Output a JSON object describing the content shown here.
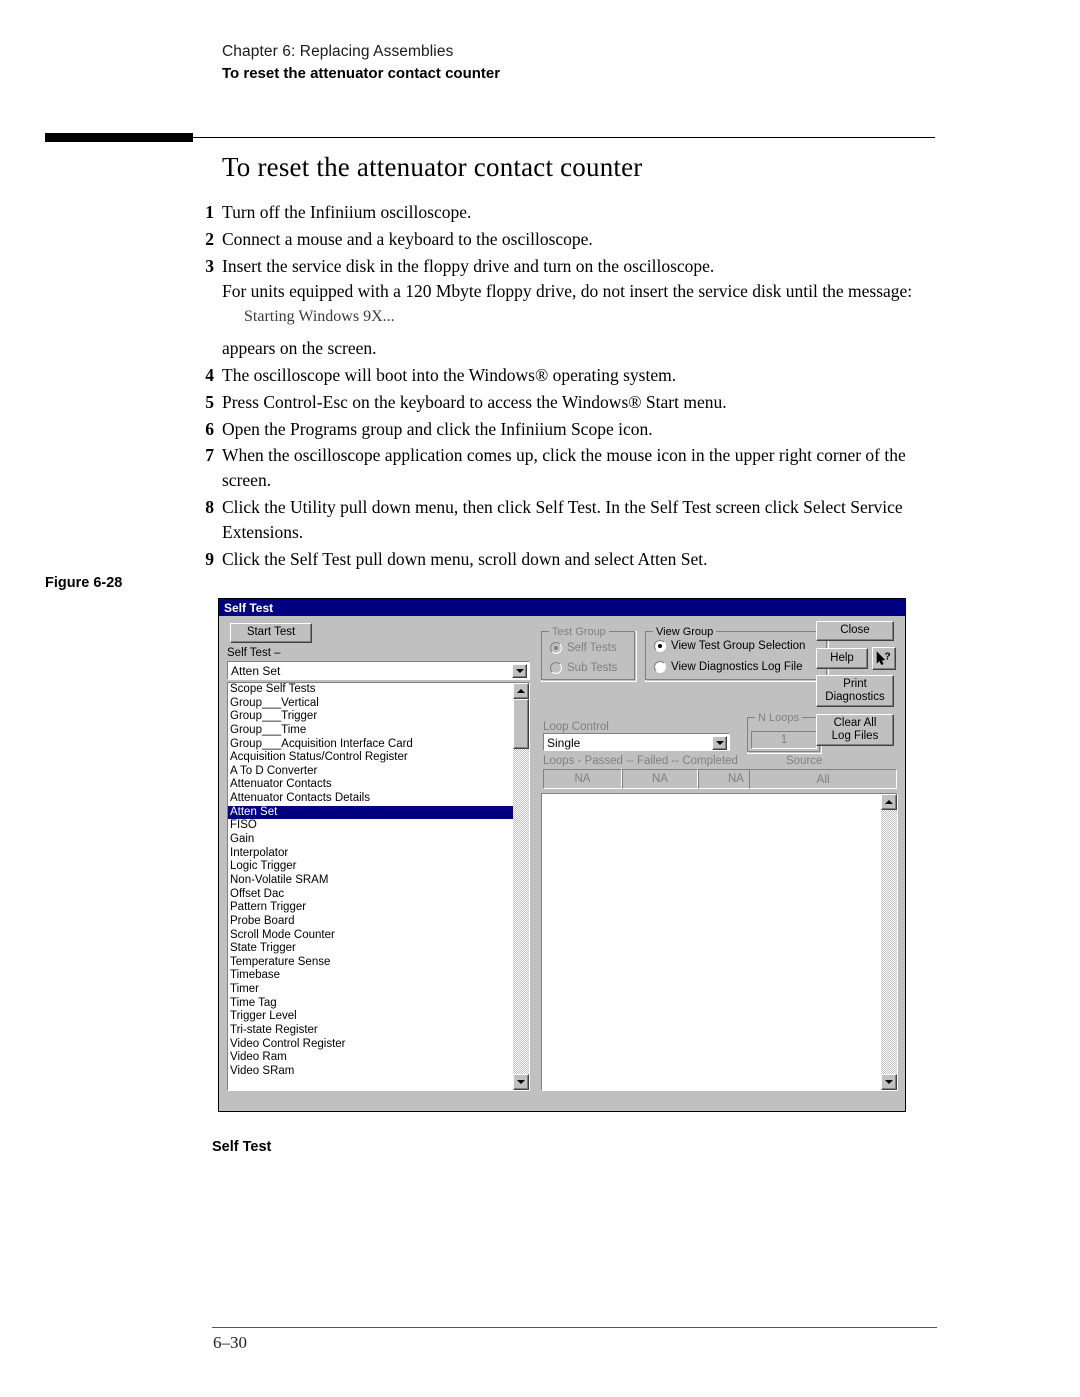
{
  "running_head": {
    "chapter": "Chapter 6: Replacing Assemblies",
    "section": "To reset the attenuator contact counter"
  },
  "page_title": "To reset the attenuator contact counter",
  "steps": [
    {
      "num": "1",
      "text": "Turn off the Infiniium oscilloscope."
    },
    {
      "num": "2",
      "text": "Connect a mouse and a keyboard to the oscilloscope."
    },
    {
      "num": "3",
      "text": "Insert the service disk in the floppy drive and turn on the oscilloscope.",
      "text2": "For units equipped with a 120 Mbyte floppy drive, do not insert the service disk until the message:",
      "code": "Starting Windows 9X...",
      "after": "appears on the screen."
    },
    {
      "num": "4",
      "text": "The oscilloscope will boot into the Windows® operating system."
    },
    {
      "num": "5",
      "text": "Press Control-Esc on the keyboard to access the Windows® Start menu."
    },
    {
      "num": "6",
      "text": "Open the Programs group and click the Infiniium Scope icon."
    },
    {
      "num": "7",
      "text": "When the oscilloscope application comes up, click the mouse icon in the upper right corner of the screen."
    },
    {
      "num": "8",
      "text": "Click the Utility pull down menu, then click Self Test. In the Self Test screen click Select Service Extensions."
    },
    {
      "num": "9",
      "text": "Click the Self Test pull down menu, scroll down and select Atten Set."
    }
  ],
  "figure": {
    "label": "Figure 6-28",
    "caption": "Self Test"
  },
  "footer": {
    "page_number": "6–30"
  },
  "dialog": {
    "title": "Self Test",
    "start_test_label": "Start Test",
    "selftest_label": "Self Test –",
    "selftest_selected": "Atten Set",
    "list_items": [
      "Scope Self Tests",
      "Group___Vertical",
      "Group___Trigger",
      "Group___Time",
      "Group___Acquisition Interface Card",
      "Acquisition Status/Control Register",
      "A To D Converter",
      "Attenuator Contacts",
      "Attenuator Contacts Details",
      "Atten Set",
      "FISO",
      "Gain",
      "Interpolator",
      "Logic Trigger",
      "Non-Volatile SRAM",
      "Offset Dac",
      "Pattern Trigger",
      "Probe Board",
      "Scroll Mode Counter",
      "State Trigger",
      "Temperature Sense",
      "Timebase",
      "Timer",
      "Time Tag",
      "Trigger Level",
      "Tri-state Register",
      "Video Control Register",
      "Video Ram",
      "Video SRam"
    ],
    "selected_list_index": 9,
    "test_group": {
      "title": "Test Group",
      "options": [
        "Self Tests",
        "Sub Tests"
      ],
      "selected_index": 0,
      "disabled": true
    },
    "view_group": {
      "title": "View Group",
      "options": [
        "View Test Group Selection",
        "View Diagnostics Log File"
      ],
      "selected_index": 0
    },
    "loop_control": {
      "label": "Loop Control",
      "value": "Single",
      "n_loops_label": "N  Loops",
      "n_loops_value": "1"
    },
    "results": {
      "header": "Loops - Passed    -- Failed --   Completed",
      "passed": "NA",
      "failed": "NA",
      "completed": "NA",
      "source_label": "Source",
      "source_value": "All"
    },
    "buttons": {
      "close": "Close",
      "help": "Help",
      "help_cursor_icon": "help-pointer-icon",
      "print_line1": "Print",
      "print_line2": "Diagnostics",
      "clear_line1": "Clear All",
      "clear_line2": "Log Files"
    },
    "colors": {
      "titlebar": "#000080",
      "face": "#c0c0c0",
      "selection": "#000080",
      "disabled_text": "#808080"
    }
  }
}
